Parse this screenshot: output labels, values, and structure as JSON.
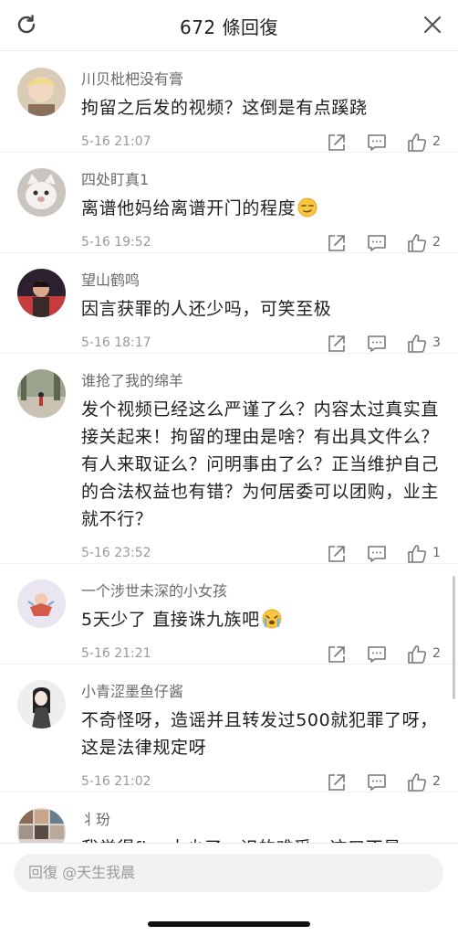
{
  "header": {
    "title": "672 條回復"
  },
  "comments": [
    {
      "username": "川贝枇杷没有膏",
      "text": "拘留之后发的视频？这倒是有点蹊跷",
      "time": "5-16 21:07",
      "likes": "2"
    },
    {
      "username": "四处盯真1",
      "text": "离谱他妈给离谱开门的程度",
      "time": "5-16 19:52",
      "likes": "2"
    },
    {
      "username": "望山鹤鸣",
      "text": "因言获罪的人还少吗，可笑至极",
      "time": "5-16 18:17",
      "likes": "3"
    },
    {
      "username": "谁抢了我的绵羊",
      "text": "发个视频已经这么严谨了么？内容太过真实直接关起来！拘留的理由是啥？有出具文件么？有人来取证么？问明事由了么？正当维护自己的合法权益也有错？为何居委可以团购，业主就不行？",
      "time": "5-16 23:52",
      "likes": "1"
    },
    {
      "username": "一个涉世未深的小女孩",
      "text": "5天少了 直接诛九族吧",
      "time": "5-16 21:21",
      "likes": "2"
    },
    {
      "username": "小青涩墨鱼仔酱",
      "text": "不奇怪呀，造谣并且转发过500就犯罪了呀，这是法律规定呀",
      "time": "5-16 21:02",
      "likes": "2"
    },
    {
      "username": "丬玢",
      "text": "我觉得five太少了，识的难受，这口不是"
    }
  ],
  "reply": {
    "placeholder": "回復 @天生我晨"
  }
}
